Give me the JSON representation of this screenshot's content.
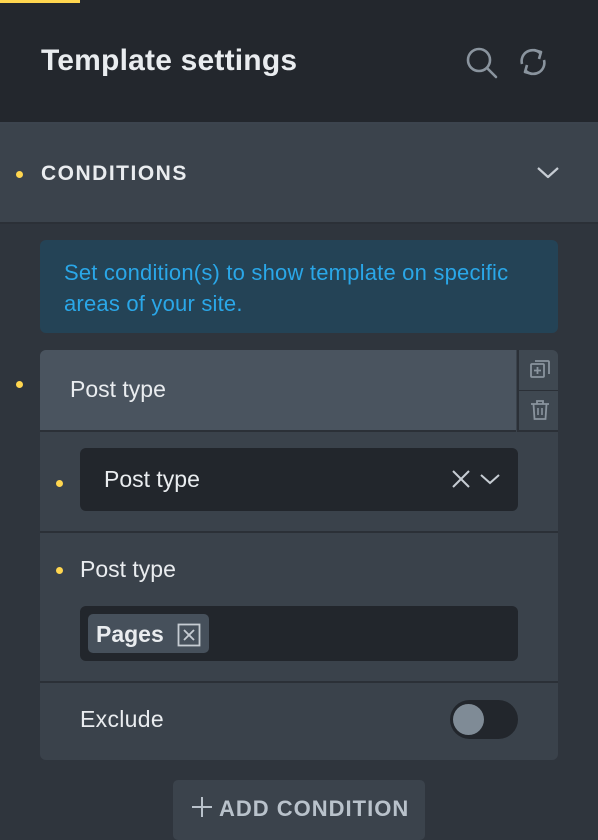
{
  "header": {
    "title": "Template settings",
    "icons": [
      "search-icon",
      "refresh-icon"
    ]
  },
  "section": {
    "title": "CONDITIONS",
    "expanded": true
  },
  "info": {
    "message": "Set condition(s) to show template on specific areas of your site."
  },
  "condition": {
    "title": "Post type",
    "actions": [
      "duplicate-icon",
      "trash-icon"
    ],
    "select": {
      "value": "Post type"
    },
    "post_type_field": {
      "label": "Post type",
      "tags": [
        {
          "label": "Pages"
        }
      ]
    },
    "exclude": {
      "label": "Exclude",
      "enabled": false
    }
  },
  "add_button": {
    "label": "ADD CONDITION"
  },
  "colors": {
    "accent": "#ffd64f",
    "info_text": "#2aa7e8",
    "info_bg": "#244356"
  }
}
